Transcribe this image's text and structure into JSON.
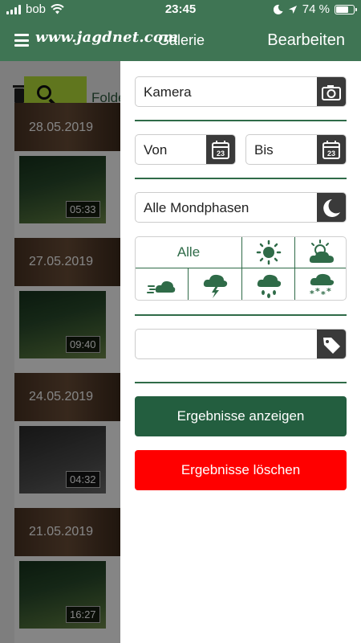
{
  "status_bar": {
    "carrier": "bob",
    "time": "23:45",
    "battery": "74 %",
    "battery_level": 0.74
  },
  "header": {
    "logo": "www.jagdnet.com",
    "title": "Galerie",
    "action": "Bearbeiten"
  },
  "gallery": {
    "folder_label": "Folde",
    "top_date": "28.05.2019",
    "items": [
      {
        "date": "",
        "duration": "05:33"
      },
      {
        "date": "27.05.2019",
        "duration": "09:40"
      },
      {
        "date": "24.05.2019",
        "duration": "04:32"
      },
      {
        "date": "21.05.2019",
        "duration": "16:27"
      }
    ]
  },
  "filter": {
    "camera_label": "Kamera",
    "from_label": "Von",
    "to_label": "Bis",
    "calendar_day": "23",
    "moon_label": "Alle Mondphasen",
    "weather_all": "Alle",
    "weather_icons": [
      "sun-icon",
      "cloud-sun-icon",
      "wind-cloud-icon",
      "thunderstorm-icon",
      "rain-icon",
      "snow-icon"
    ],
    "tag_value": "",
    "show_button": "Ergebnisse anzeigen",
    "clear_button": "Ergebnisse löschen"
  },
  "colors": {
    "brand_green": "#3f7554",
    "accent_lime": "#b9e23a",
    "primary_button": "#235e3f",
    "danger_button": "#ff0000"
  }
}
